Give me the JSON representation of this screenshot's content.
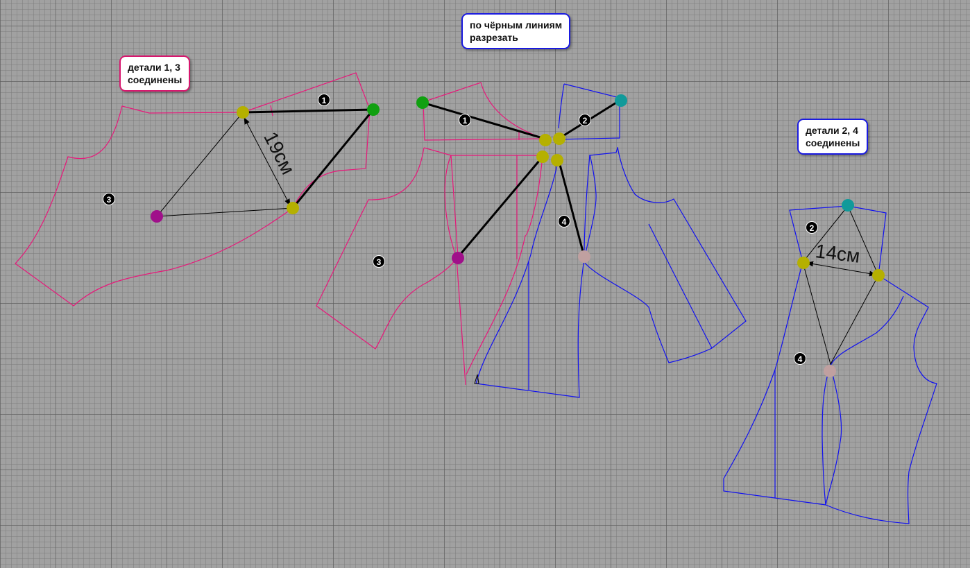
{
  "callouts": {
    "left": {
      "line1": "детали 1, 3",
      "line2": "соединены"
    },
    "center": {
      "line1": "по чёрным линиям",
      "line2": "разрезать"
    },
    "right": {
      "line1": "детали 2, 4",
      "line2": "соединены"
    }
  },
  "badges": {
    "one": "1",
    "two": "2",
    "three": "3",
    "four": "4"
  },
  "measurements": {
    "left": "19см",
    "right": "14см"
  },
  "colors": {
    "piece_pink": "#e8177a",
    "piece_blue": "#1010f0",
    "dot_yellow": "#b5b000",
    "dot_green": "#10a010",
    "dot_teal": "#119a9a",
    "dot_magenta": "#a0108a",
    "dot_rose": "#c0a0a0",
    "background": "#a1a1a1"
  }
}
